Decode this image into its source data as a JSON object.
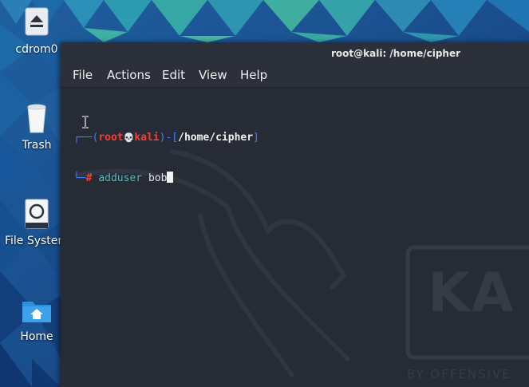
{
  "desktop": {
    "icons": [
      {
        "label": "cdrom0",
        "icon": "eject-icon"
      },
      {
        "label": "Trash",
        "icon": "trash-icon"
      },
      {
        "label": "File System",
        "icon": "drive-icon"
      },
      {
        "label": "Home",
        "icon": "home-folder-icon"
      }
    ]
  },
  "terminal": {
    "title": "root@kali: /home/cipher",
    "menu": [
      "File",
      "Actions",
      "Edit",
      "View",
      "Help"
    ],
    "prompt": {
      "open": "┌──(",
      "user": "root",
      "skull": "💀",
      "host": "kali",
      "sep": ")-[",
      "path": "/home/cipher",
      "close": "]",
      "line2_prefix": "└─",
      "hash": "#",
      "command": "adduser",
      "argument": "bob"
    },
    "watermark": {
      "brand": "KA",
      "tagline": "BY OFFENSIVE"
    }
  },
  "colors": {
    "terminal_bg": "#262b35",
    "prompt_bracket": "#3d7eff",
    "prompt_user": "#ff3b30",
    "command": "#5fb3b3"
  }
}
